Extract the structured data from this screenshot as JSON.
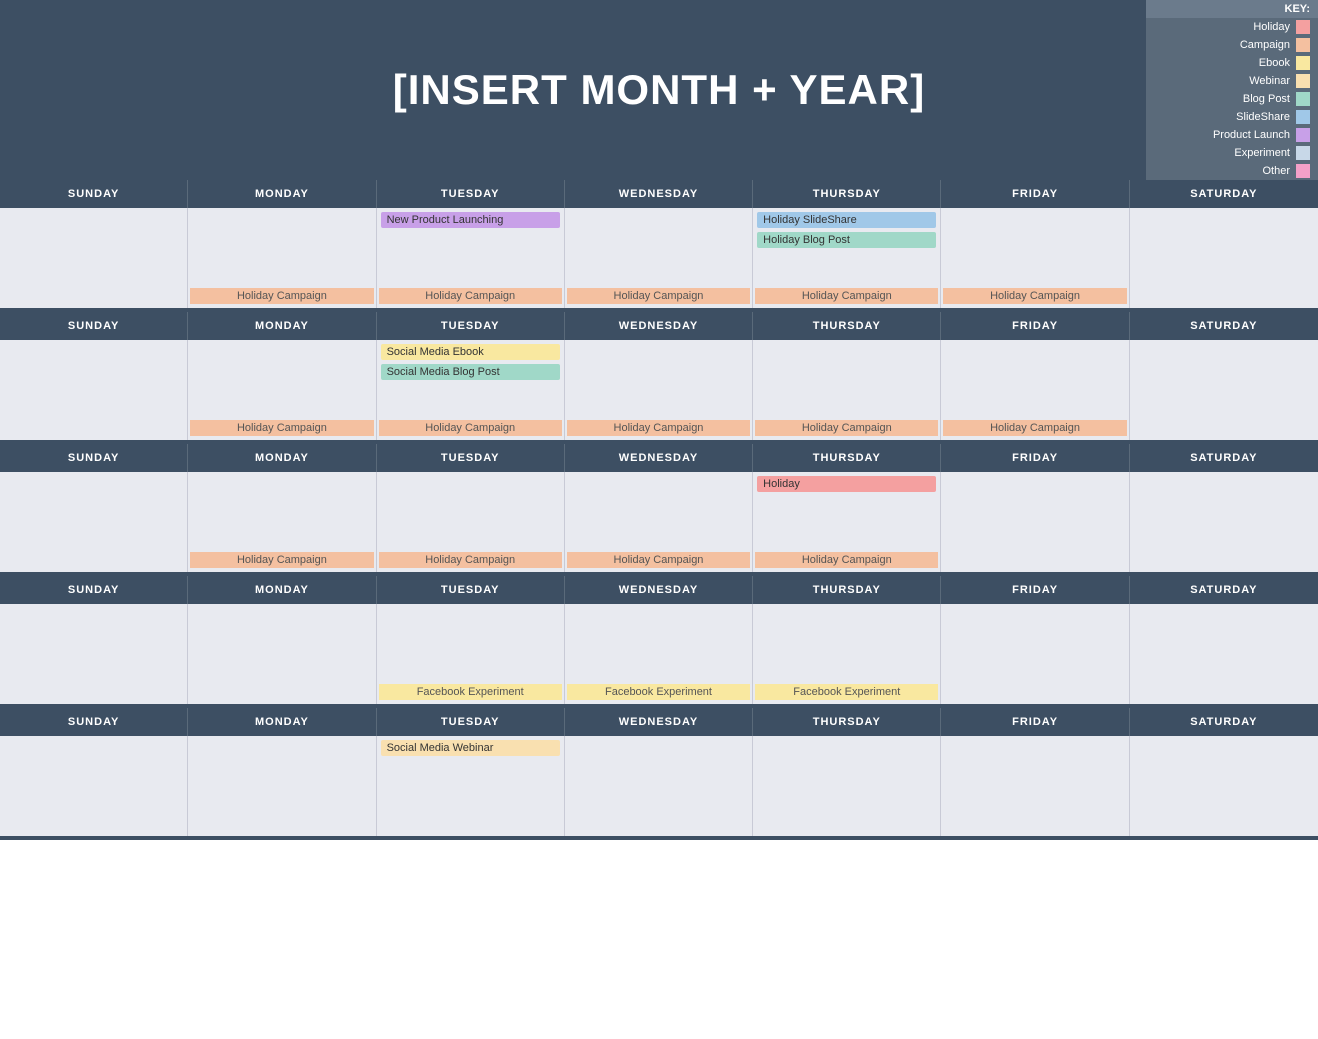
{
  "header": {
    "title": "[INSERT MONTH + YEAR]"
  },
  "key": {
    "title": "KEY:",
    "items": [
      {
        "label": "Holiday",
        "color": "#f4a0a0"
      },
      {
        "label": "Campaign",
        "color": "#f4c0a0"
      },
      {
        "label": "Ebook",
        "color": "#f9e8a0"
      },
      {
        "label": "Webinar",
        "color": "#f9e0b0"
      },
      {
        "label": "Blog Post",
        "color": "#a0d8c8"
      },
      {
        "label": "SlideShare",
        "color": "#a0c8e8"
      },
      {
        "label": "Product Launch",
        "color": "#c8a0e8"
      },
      {
        "label": "Experiment",
        "color": "#c8d8e8"
      },
      {
        "label": "Other",
        "color": "#f4a0c8"
      }
    ]
  },
  "days": [
    "SUNDAY",
    "MONDAY",
    "TUESDAY",
    "WEDNESDAY",
    "THURSDAY",
    "FRIDAY",
    "SATURDAY"
  ],
  "weeks": [
    {
      "cells": [
        {
          "events": [],
          "bottom": ""
        },
        {
          "events": [],
          "bottom": "Holiday Campaign"
        },
        {
          "events": [
            "New Product Launching"
          ],
          "bottom": "Holiday Campaign"
        },
        {
          "events": [],
          "bottom": "Holiday Campaign"
        },
        {
          "events": [
            "Holiday SlideShare",
            "Holiday Blog Post"
          ],
          "bottom": "Holiday Campaign"
        },
        {
          "events": [],
          "bottom": "Holiday Campaign"
        },
        {
          "events": [],
          "bottom": ""
        }
      ]
    },
    {
      "cells": [
        {
          "events": [],
          "bottom": ""
        },
        {
          "events": [],
          "bottom": "Holiday Campaign"
        },
        {
          "events": [
            "Social Media Ebook",
            "Social Media Blog Post"
          ],
          "bottom": "Holiday Campaign"
        },
        {
          "events": [],
          "bottom": "Holiday Campaign"
        },
        {
          "events": [],
          "bottom": "Holiday Campaign"
        },
        {
          "events": [],
          "bottom": "Holiday Campaign"
        },
        {
          "events": [],
          "bottom": ""
        }
      ]
    },
    {
      "cells": [
        {
          "events": [],
          "bottom": ""
        },
        {
          "events": [],
          "bottom": "Holiday Campaign"
        },
        {
          "events": [],
          "bottom": "Holiday Campaign"
        },
        {
          "events": [],
          "bottom": "Holiday Campaign"
        },
        {
          "events": [
            "Holiday"
          ],
          "bottom": "Holiday Campaign"
        },
        {
          "events": [],
          "bottom": ""
        },
        {
          "events": [],
          "bottom": ""
        }
      ]
    },
    {
      "cells": [
        {
          "events": [],
          "bottom": ""
        },
        {
          "events": [],
          "bottom": ""
        },
        {
          "events": [],
          "bottom": "Facebook Experiment"
        },
        {
          "events": [],
          "bottom": "Facebook Experiment"
        },
        {
          "events": [],
          "bottom": "Facebook Experiment"
        },
        {
          "events": [],
          "bottom": ""
        },
        {
          "events": [],
          "bottom": ""
        }
      ]
    },
    {
      "cells": [
        {
          "events": [],
          "bottom": ""
        },
        {
          "events": [],
          "bottom": ""
        },
        {
          "events": [
            "Social Media Webinar"
          ],
          "bottom": ""
        },
        {
          "events": [],
          "bottom": ""
        },
        {
          "events": [],
          "bottom": ""
        },
        {
          "events": [],
          "bottom": ""
        },
        {
          "events": [],
          "bottom": ""
        }
      ]
    }
  ]
}
